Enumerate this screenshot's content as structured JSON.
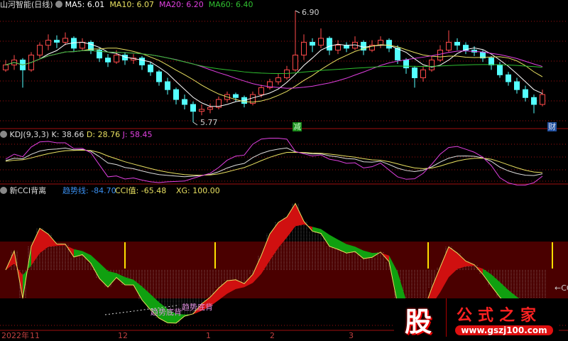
{
  "header": {
    "stock": "山河智能(日线)",
    "ma5": "MA5: 6.01",
    "ma10": "MA10: 6.07",
    "ma20": "MA20: 6.20",
    "ma60": "MA60: 6.40"
  },
  "kdj_header": {
    "name": "KDJ(9,3,3)",
    "k": "K: 38.66",
    "d": "D: 28.76",
    "j": "J: 58.45"
  },
  "cci_header": {
    "name": "新CCI背离",
    "trend": "趋势线: -84.70",
    "cci": "CCI值: -65.48",
    "xg": "XG: 100.00"
  },
  "annotations": {
    "high": "6.90",
    "low": "5.77",
    "div1": "趋势底背",
    "div2": "趋势底背",
    "reduce": "减",
    "finance": "财",
    "cc": "CC"
  },
  "x_axis": [
    "2022年",
    "11",
    "12",
    "1",
    "2",
    "3"
  ],
  "logo": {
    "char": "股",
    "name": "公式之家",
    "url": "www.gszj100.com"
  },
  "colors": {
    "up": "#ff4a4a",
    "down": "#54ffff",
    "ma5": "#ffffff",
    "ma10": "#e8e060",
    "ma20": "#e040e0",
    "ma60": "#30c030",
    "grid": "#a01010",
    "band": "#4a0000",
    "cci_up": "#d01010",
    "cci_down": "#10a010"
  },
  "chart_data": {
    "type": "candlestick",
    "price_range": [
      5.77,
      6.9
    ],
    "ohlc": [
      [
        6.3,
        6.4,
        6.28,
        6.35
      ],
      [
        6.35,
        6.45,
        6.3,
        6.4
      ],
      [
        6.4,
        6.42,
        6.12,
        6.3
      ],
      [
        6.3,
        6.48,
        6.28,
        6.45
      ],
      [
        6.45,
        6.58,
        6.42,
        6.55
      ],
      [
        6.55,
        6.66,
        6.5,
        6.6
      ],
      [
        6.6,
        6.65,
        6.52,
        6.58
      ],
      [
        6.58,
        6.68,
        6.55,
        6.62
      ],
      [
        6.62,
        6.64,
        6.48,
        6.52
      ],
      [
        6.52,
        6.62,
        6.5,
        6.58
      ],
      [
        6.58,
        6.6,
        6.46,
        6.5
      ],
      [
        6.5,
        6.52,
        6.38,
        6.42
      ],
      [
        6.42,
        6.46,
        6.33,
        6.38
      ],
      [
        6.38,
        6.5,
        6.36,
        6.45
      ],
      [
        6.45,
        6.48,
        6.35,
        6.4
      ],
      [
        6.4,
        6.46,
        6.36,
        6.42
      ],
      [
        6.42,
        6.44,
        6.3,
        6.35
      ],
      [
        6.35,
        6.38,
        6.24,
        6.28
      ],
      [
        6.28,
        6.3,
        6.14,
        6.18
      ],
      [
        6.18,
        6.22,
        6.05,
        6.1
      ],
      [
        6.1,
        6.12,
        5.95,
        6.0
      ],
      [
        6.0,
        6.05,
        5.9,
        5.95
      ],
      [
        5.95,
        5.98,
        5.77,
        5.88
      ],
      [
        5.88,
        5.95,
        5.84,
        5.9
      ],
      [
        5.9,
        5.96,
        5.86,
        5.92
      ],
      [
        5.92,
        6.03,
        5.9,
        6.0
      ],
      [
        6.0,
        6.08,
        5.97,
        6.05
      ],
      [
        6.05,
        6.07,
        5.98,
        6.02
      ],
      [
        6.02,
        6.04,
        5.92,
        5.96
      ],
      [
        5.96,
        6.08,
        5.94,
        6.05
      ],
      [
        6.05,
        6.15,
        6.02,
        6.12
      ],
      [
        6.12,
        6.21,
        6.1,
        6.18
      ],
      [
        6.18,
        6.26,
        6.15,
        6.22
      ],
      [
        6.22,
        6.34,
        6.2,
        6.3
      ],
      [
        6.3,
        6.9,
        6.28,
        6.45
      ],
      [
        6.45,
        6.66,
        6.4,
        6.58
      ],
      [
        6.58,
        6.62,
        6.48,
        6.55
      ],
      [
        6.55,
        6.72,
        6.52,
        6.62
      ],
      [
        6.62,
        6.64,
        6.45,
        6.5
      ],
      [
        6.5,
        6.6,
        6.46,
        6.55
      ],
      [
        6.55,
        6.58,
        6.48,
        6.52
      ],
      [
        6.52,
        6.64,
        6.5,
        6.58
      ],
      [
        6.58,
        6.6,
        6.45,
        6.5
      ],
      [
        6.5,
        6.6,
        6.48,
        6.55
      ],
      [
        6.55,
        6.64,
        6.52,
        6.6
      ],
      [
        6.6,
        6.62,
        6.48,
        6.52
      ],
      [
        6.52,
        6.55,
        6.36,
        6.4
      ],
      [
        6.4,
        6.42,
        6.26,
        6.32
      ],
      [
        6.32,
        6.34,
        6.12,
        6.22
      ],
      [
        6.22,
        6.34,
        6.18,
        6.3
      ],
      [
        6.3,
        6.44,
        6.28,
        6.4
      ],
      [
        6.4,
        6.55,
        6.38,
        6.5
      ],
      [
        6.5,
        6.7,
        6.48,
        6.58
      ],
      [
        6.58,
        6.62,
        6.5,
        6.55
      ],
      [
        6.55,
        6.58,
        6.46,
        6.5
      ],
      [
        6.5,
        6.54,
        6.44,
        6.48
      ],
      [
        6.48,
        6.5,
        6.38,
        6.42
      ],
      [
        6.42,
        6.44,
        6.3,
        6.35
      ],
      [
        6.35,
        6.38,
        6.22,
        6.25
      ],
      [
        6.25,
        6.28,
        6.14,
        6.18
      ],
      [
        6.18,
        6.22,
        6.06,
        6.1
      ],
      [
        6.1,
        6.14,
        5.98,
        6.02
      ],
      [
        6.02,
        6.05,
        5.86,
        5.95
      ],
      [
        5.95,
        6.1,
        5.93,
        6.05
      ]
    ]
  }
}
